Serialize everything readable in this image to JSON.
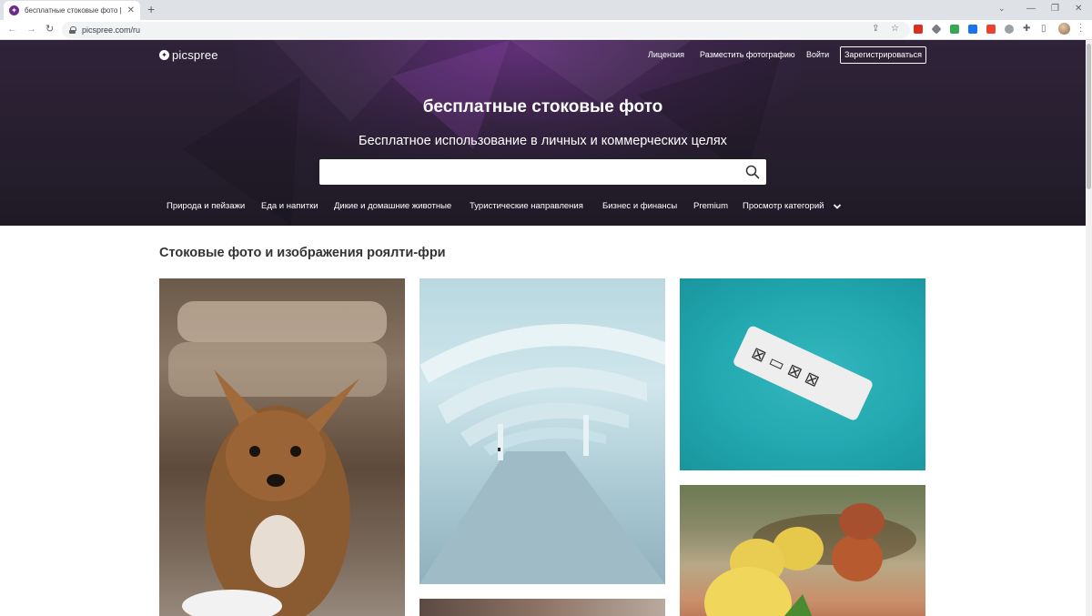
{
  "browser": {
    "tab_title": "бесплатные стоковые фото | сто",
    "url": "picspree.com/ru"
  },
  "header": {
    "logo_text": "picspree",
    "nav": {
      "license": "Лицензия",
      "upload": "Разместить фотографию",
      "login": "Войти",
      "signup": "Зарегистрироваться"
    }
  },
  "hero": {
    "title": "бесплатные стоковые фото",
    "subtitle": "Бесплатное использование в личных и коммерческих целях",
    "search": {
      "value": "",
      "placeholder": ""
    }
  },
  "categories": [
    "Природа и пейзажи",
    "Еда и напитки",
    "Дикие и домашние животные",
    "Туристические направления",
    "Бизнес и финансы",
    "Premium",
    "Просмотр категорий"
  ],
  "main": {
    "section_title": "Стоковые фото и изображения роялти-фри"
  },
  "colors": {
    "hero_bg": "#241d2c",
    "accent_purple": "#6a2c8a"
  }
}
